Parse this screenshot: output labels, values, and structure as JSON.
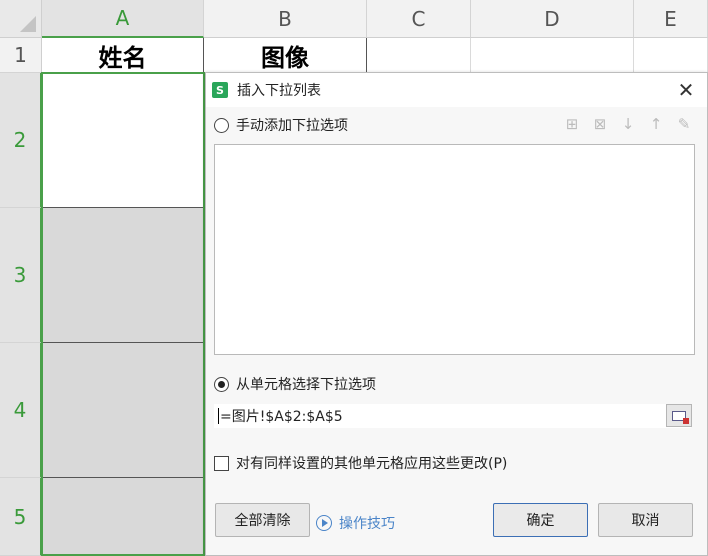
{
  "sheet": {
    "columns": [
      "A",
      "B",
      "C",
      "D",
      "E"
    ],
    "rows": [
      "1",
      "2",
      "3",
      "4",
      "5"
    ],
    "header_cells": {
      "a1": "姓名",
      "b1": "图像"
    }
  },
  "dialog": {
    "title": "插入下拉列表",
    "app_icon": "S",
    "manual_option_label": "手动添加下拉选项",
    "cell_option_label": "从单元格选择下拉选项",
    "source_formula": "=图片!$A$2:$A$5",
    "apply_all_label": "对有同样设置的其他单元格应用这些更改(P)",
    "clear_all_label": "全部清除",
    "tips_label": "操作技巧",
    "ok_label": "确定",
    "cancel_label": "取消",
    "toolbar_icons": [
      "add-item-icon",
      "delete-item-icon",
      "move-down-icon",
      "move-up-icon",
      "edit-icon"
    ],
    "manual_selected": false,
    "cell_selected": true,
    "apply_all_checked": false
  },
  "colors": {
    "accent_green": "#4aa04a",
    "app_icon_green": "#2aa65a",
    "link_blue": "#4a84c8",
    "primary_border": "#3c6fb5"
  }
}
